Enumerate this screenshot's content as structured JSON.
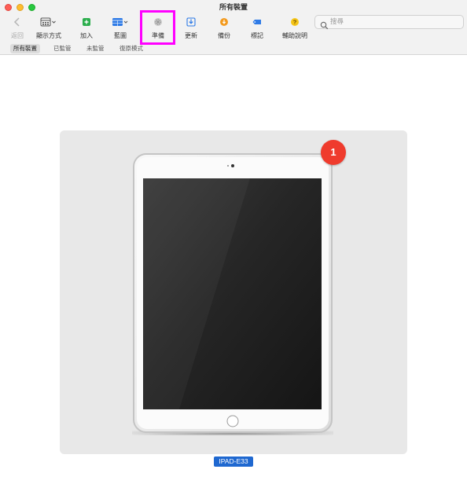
{
  "window": {
    "title": "所有裝置"
  },
  "toolbar": {
    "items": [
      {
        "label": "返回",
        "icon": "chevron-left-icon",
        "enabled": false
      },
      {
        "label": "顯示方式",
        "icon": "view-options-icon",
        "enabled": true
      },
      {
        "label": "加入",
        "icon": "add-icon",
        "enabled": true
      },
      {
        "label": "藍圖",
        "icon": "blueprint-icon",
        "enabled": true
      },
      {
        "label": "準備",
        "icon": "prepare-gear-icon",
        "enabled": true,
        "highlighted": true
      },
      {
        "label": "更新",
        "icon": "update-icon",
        "enabled": true
      },
      {
        "label": "備份",
        "icon": "backup-icon",
        "enabled": true
      },
      {
        "label": "標記",
        "icon": "tag-icon",
        "enabled": true
      },
      {
        "label": "輔助說明",
        "icon": "help-icon",
        "enabled": true
      }
    ],
    "search": {
      "placeholder": "搜尋",
      "value": ""
    }
  },
  "filters": [
    {
      "label": "所有裝置",
      "active": true
    },
    {
      "label": "已監管",
      "active": false
    },
    {
      "label": "未監管",
      "active": false
    },
    {
      "label": "復原模式",
      "active": false
    }
  ],
  "device": {
    "name": "IPAD-E33",
    "badge_count": "1",
    "badge_color": "#ef3b2d",
    "label_color": "#1f68d0"
  },
  "colors": {
    "highlight": "#ff00ff",
    "accent_green": "#2cae4d",
    "accent_blue": "#2f7be6",
    "accent_orange": "#f39a1e",
    "accent_yellow": "#f5c518"
  }
}
